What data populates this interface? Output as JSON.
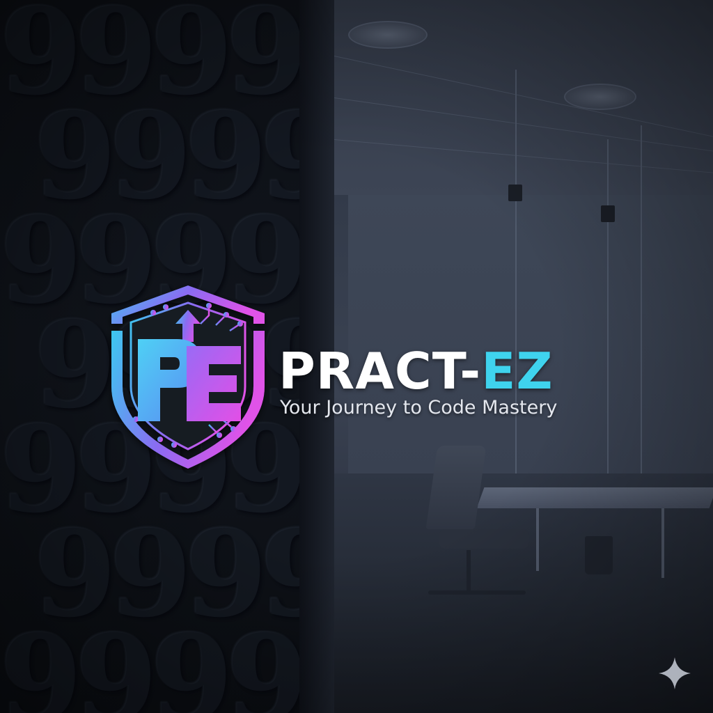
{
  "logo": {
    "monogram": "PE",
    "brand_name_part1": "PRACT-",
    "brand_name_part2": "EZ",
    "tagline": "Your Journey to Code Mastery",
    "emblem_icon": "shield-circuit-icon"
  },
  "colors": {
    "brand_white": "#ffffff",
    "brand_cyan": "#3fd3ee",
    "gradient_start": "#3cc8f0",
    "gradient_mid": "#8a6cf2",
    "gradient_end": "#e052e8",
    "background_dark": "#0f1219"
  },
  "decorations": {
    "wall_pattern_glyph": "9",
    "corner_icon": "sparkle-icon"
  }
}
